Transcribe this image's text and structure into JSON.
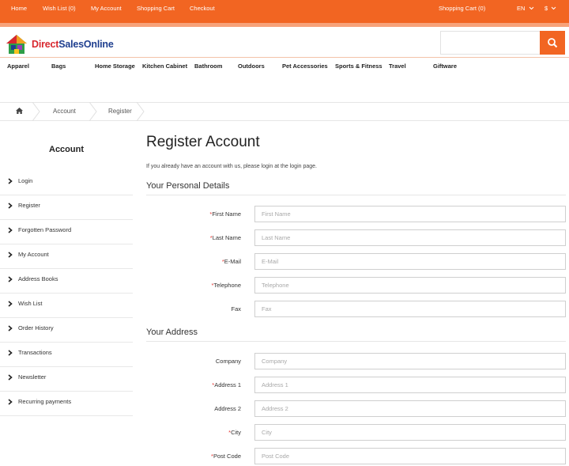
{
  "topbar": {
    "links": [
      "Home",
      "Wish List (0)",
      "My Account",
      "Shopping Cart",
      "Checkout"
    ],
    "cart": "Shopping Cart (0)",
    "language": "EN",
    "currency": "$"
  },
  "logo": {
    "part1": "Direct",
    "part2": "SalesOnline"
  },
  "categories": [
    "Apparel",
    "Bags",
    "Home Storage",
    "Kitchen Cabinet",
    "Bathroom",
    "Outdoors",
    "Pet Accessories",
    "Sports & Fitness",
    "Travel",
    "Giftware"
  ],
  "breadcrumb": [
    "Account",
    "Register"
  ],
  "sidebar": {
    "title": "Account",
    "items": [
      "Login",
      "Register",
      "Forgotten Password",
      "My Account",
      "Address Books",
      "Wish List",
      "Order History",
      "Transactions",
      "Newsletter",
      "Recurring payments"
    ]
  },
  "page": {
    "title": "Register Account",
    "intro": "If you already have an account with us, please login at the login page."
  },
  "personal": {
    "heading": "Your Personal Details",
    "fields": [
      {
        "label": "First Name",
        "required": "*",
        "placeholder": "First Name"
      },
      {
        "label": "Last Name",
        "required": "*",
        "placeholder": "Last Name"
      },
      {
        "label": "E-Mail",
        "required": "*",
        "placeholder": "E-Mail"
      },
      {
        "label": "Telephone",
        "required": "*",
        "placeholder": "Telephone"
      },
      {
        "label": "Fax",
        "required": "",
        "placeholder": "Fax"
      }
    ]
  },
  "address": {
    "heading": "Your Address",
    "fields": [
      {
        "label": "Company",
        "required": "",
        "placeholder": "Company"
      },
      {
        "label": "Address 1",
        "required": "*",
        "placeholder": "Address 1"
      },
      {
        "label": "Address 2",
        "required": "",
        "placeholder": "Address 2"
      },
      {
        "label": "City",
        "required": "*",
        "placeholder": "City"
      },
      {
        "label": "Post Code",
        "required": "*",
        "placeholder": "Post Code"
      }
    ]
  },
  "colors": {
    "accent": "#f26522",
    "required": "#e53935"
  },
  "icons": {
    "search": "search-icon",
    "home": "home-icon",
    "dropdown": "chevron-down-icon",
    "list_arrow": "chevron-right-icon"
  }
}
